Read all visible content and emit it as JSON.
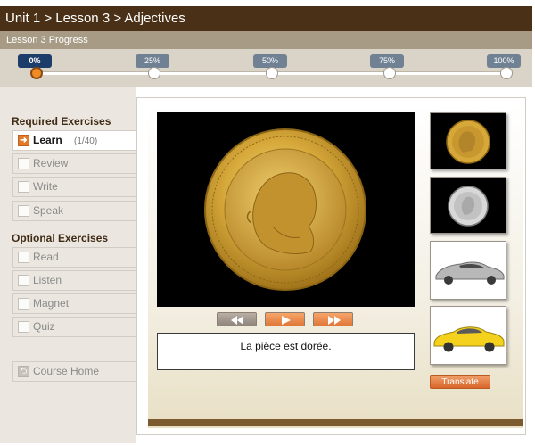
{
  "header": {
    "breadcrumb": "Unit 1 > Lesson 3 > Adjectives"
  },
  "progress": {
    "label": "Lesson 3 Progress",
    "current_percent": 0,
    "markers": [
      "0%",
      "25%",
      "50%",
      "75%",
      "100%"
    ]
  },
  "sidebar": {
    "required_title": "Required Exercises",
    "required_items": [
      {
        "label": "Learn",
        "count": "(1/40)",
        "active": true
      },
      {
        "label": "Review"
      },
      {
        "label": "Write"
      },
      {
        "label": "Speak"
      }
    ],
    "optional_title": "Optional Exercises",
    "optional_items": [
      {
        "label": "Read"
      },
      {
        "label": "Listen"
      },
      {
        "label": "Magnet"
      },
      {
        "label": "Quiz"
      }
    ],
    "course_home": "Course Home"
  },
  "main": {
    "sentence": "La pièce est dorée.",
    "translate_label": "Translate",
    "main_image": "gold-coin",
    "thumbnails": [
      "gold-coin",
      "silver-coin",
      "silver-car",
      "yellow-car"
    ],
    "controls": [
      "rewind-icon",
      "play-icon",
      "fast-forward-icon"
    ]
  },
  "colors": {
    "header_bg": "#4a3016",
    "accent": "#e2741b",
    "active_marker": "#1c3c6a"
  }
}
